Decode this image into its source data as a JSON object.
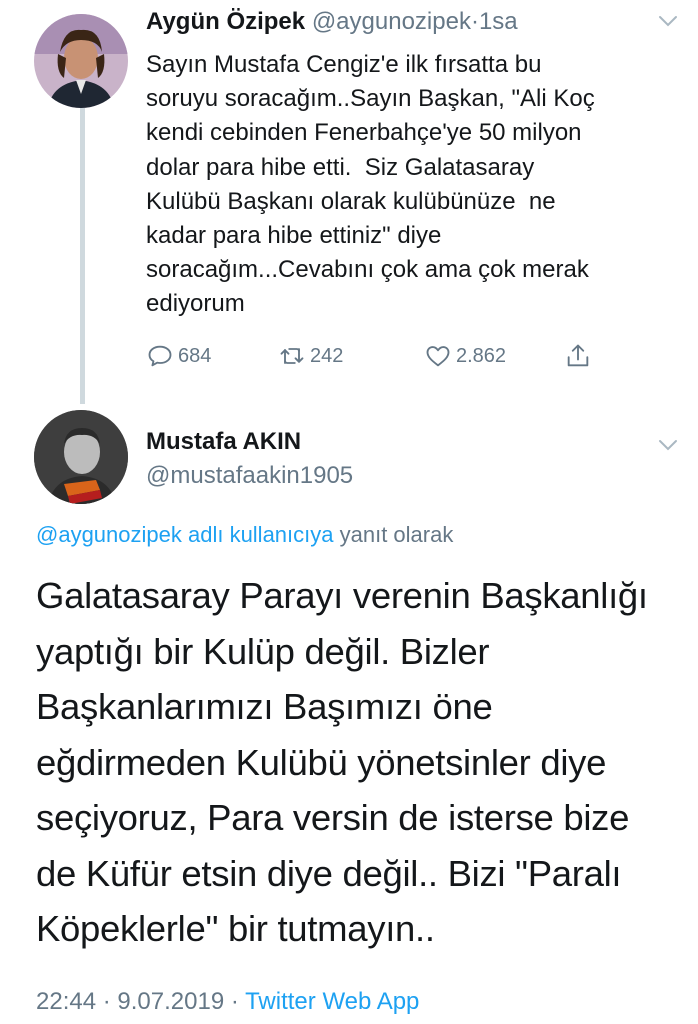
{
  "reply_tweet": {
    "name": "Aygün Özipek",
    "handle": "@aygunozipek",
    "separator": "·",
    "time": "1sa",
    "text": "Sayın Mustafa Cengiz'e ilk fırsatta bu\nsoruyu soracağım..Sayın Başkan, \"Ali Koç\nkendi cebinden Fenerbahçe'ye 50 milyon\ndolar para hibe etti.  Siz Galatasaray\nKulübü Başkanı olarak kulübünüze  ne\nkadar para hibe ettiniz\" diye\nsoracağım...Cevabını çok ama çok merak\nediyorum",
    "reply_count": "684",
    "retweet_count": "242",
    "like_count": "2.862",
    "icons": [
      "reply-icon",
      "retweet-icon",
      "like-icon",
      "share-icon",
      "chevron-down-icon"
    ]
  },
  "main_tweet": {
    "name": "Mustafa AKIN",
    "handle": "@mustafaakin1905",
    "reply_context_link": "@aygunozipek adlı kullanıcıya",
    "reply_context_suffix": " yanıt olarak",
    "text": "Galatasaray Parayı verenin Başkanlığı\nyaptığı bir Kulüp değil. Bizler\nBaşkanlarımızı Başımızı öne\neğdirmeden Kulübü yönetsinler diye\nseçiyoruz, Para versin de isterse bize\nde Küfür etsin diye değil.. Bizi \"Paralı\nKöpeklerle\" bir tutmayın..",
    "time": "22:44",
    "separator": "·",
    "date": "9.07.2019",
    "source": "Twitter Web App"
  },
  "colors": {
    "link": "#1da1f2",
    "muted": "#657786",
    "text": "#14171a",
    "thread_line": "#cfd9de"
  }
}
